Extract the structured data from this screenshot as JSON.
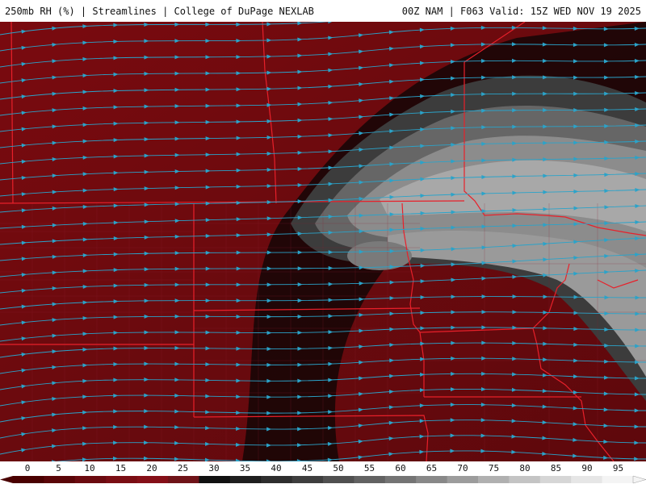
{
  "header": {
    "left_title": "250mb RH (%) | Streamlines | College of DuPage NEXLAB",
    "right_title": "00Z NAM | F063 Valid: 15Z WED NOV 19 2025"
  },
  "map": {
    "field": "250mb relative humidity",
    "overlay": "streamlines",
    "streamline_color": "#2ba3c9",
    "border_color": "#e8202a",
    "county_line_color": "#8a2030"
  },
  "colorbar": {
    "labels": [
      "0",
      "5",
      "10",
      "15",
      "20",
      "25",
      "30",
      "35",
      "40",
      "45",
      "50",
      "55",
      "60",
      "65",
      "70",
      "75",
      "80",
      "85",
      "90",
      "95"
    ],
    "colors": [
      "#4a0000",
      "#5a0508",
      "#6b0a0f",
      "#7a0d13",
      "#850f17",
      "#6f1318",
      "#101010",
      "#1e1e1e",
      "#2e2e2e",
      "#3e3e3e",
      "#505050",
      "#626262",
      "#747474",
      "#888888",
      "#9c9c9c",
      "#b0b0b0",
      "#c4c4c4",
      "#d6d6d6",
      "#e6e6e6",
      "#f4f4f4"
    ]
  }
}
